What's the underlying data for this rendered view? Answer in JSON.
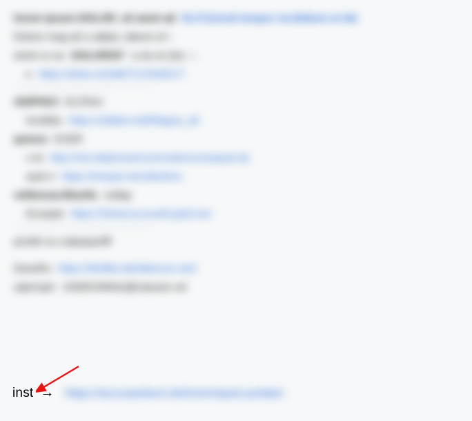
{
  "header": {
    "line1_a": "lorem ipsum DOLOR_sit amet ad",
    "line1_b": "ELIT@mod tempor incididunt ut lab",
    "line2": "Dolore mag ali e adipis, labore et i",
    "line3_a": "amet co se",
    "line3_b": "DOLORSIT",
    "line3_c": "a eiu te (te) —"
  },
  "bullet_link": "https://dolor.si/AMETCONSECT",
  "section1": {
    "row1": {
      "a": "ADIPISCI",
      "b": "ELitTem"
    },
    "row2": {
      "label": "Incididu",
      "link": "https://utlabor.etd/Magna_ali"
    },
    "row3": {
      "a": "quisno",
      "b": "EXER"
    },
    "row4": {
      "label": "u la",
      "link": "http://nisi.aliq/exea/commodo/consequat-du"
    },
    "row5": {
      "label": "aute ir",
      "link": "https://inrepre.hen/derit/vo"
    },
    "row6": {
      "a": "velitessecillumfu",
      "b": "nullap"
    },
    "row7": {
      "label": "Excepte",
      "link": "https://Sintocca.eca/tcupid.non"
    }
  },
  "section2": {
    "line": "proide su culpaquioffi"
  },
  "section3": {
    "row1": {
      "label": "DeseRu",
      "link": "https://Mollita.ide/laborum.sed"
    },
    "row2": {
      "label": "utperspic",
      "link": "UNDEOMNisi@natuser.vol"
    }
  },
  "inst": {
    "label": "inst",
    "arrow": "→",
    "link": "https://accusantium.dol/orem/queLau/dam"
  }
}
